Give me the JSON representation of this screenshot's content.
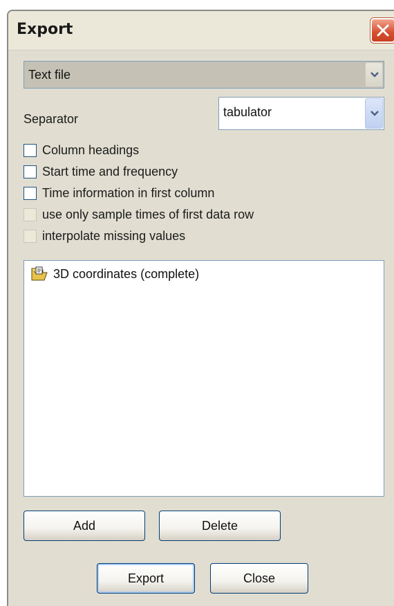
{
  "window": {
    "title": "Export"
  },
  "format": {
    "selected": "Text file"
  },
  "separator": {
    "label": "Separator",
    "selected": "tabulator"
  },
  "options": [
    {
      "label": "Column headings",
      "checked": false,
      "enabled": true
    },
    {
      "label": "Start time and frequency",
      "checked": false,
      "enabled": true
    },
    {
      "label": "Time information in first column",
      "checked": false,
      "enabled": true
    },
    {
      "label": "use only sample times of first data row",
      "checked": false,
      "enabled": false
    },
    {
      "label": "interpolate missing values",
      "checked": false,
      "enabled": false
    }
  ],
  "export_list": {
    "items": [
      {
        "label": "3D coordinates (complete)",
        "icon": "folder-document-icon"
      }
    ]
  },
  "buttons": {
    "add": "Add",
    "delete": "Delete",
    "export": "Export",
    "close": "Close"
  },
  "colors": {
    "window_bg": "#e1ded1",
    "close_red": "#d54e2e",
    "border_blue": "#7f9db9"
  }
}
